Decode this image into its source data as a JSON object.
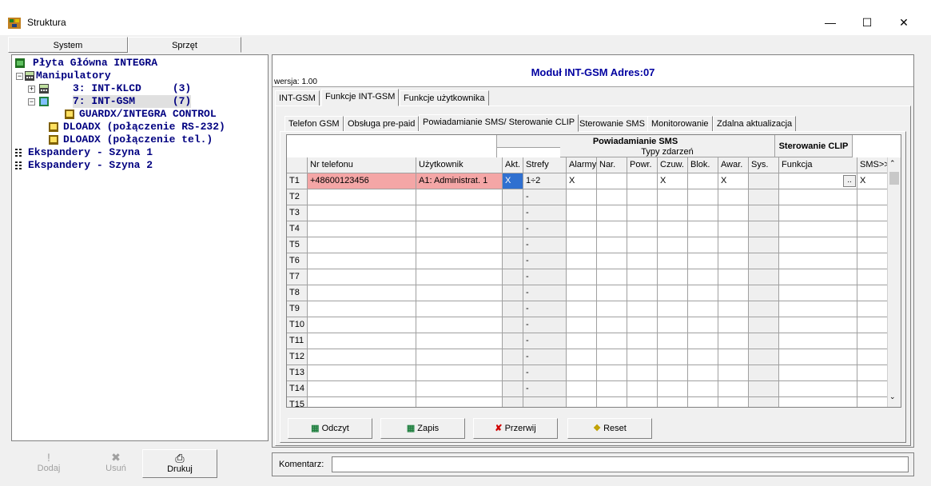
{
  "window": {
    "title": "Struktura"
  },
  "left_tabs": [
    "System",
    "Sprzęt"
  ],
  "tree": [
    {
      "label": "Płyta Główna INTEGRA"
    },
    {
      "label": "Manipulatory"
    },
    {
      "label": "3: INT-KLCD     (3)"
    },
    {
      "label": "7: INT-GSM      (7)"
    },
    {
      "label": "GUARDX/INTEGRA CONTROL"
    },
    {
      "label": "DLOADX (połączenie RS-232)"
    },
    {
      "label": "DLOADX (połączenie tel.)"
    },
    {
      "label": "Ekspandery - Szyna 1"
    },
    {
      "label": "Ekspandery - Szyna 2"
    }
  ],
  "left_buttons": {
    "add": "Dodaj",
    "remove": "Usuń",
    "print": "Drukuj"
  },
  "header": {
    "module": "Moduł INT-GSM Adres:07",
    "version": "wersja: 1.00"
  },
  "main_tabs": [
    "INT-GSM",
    "Funkcje INT-GSM",
    "Funkcje użytkownika"
  ],
  "sub_tabs": [
    "Telefon GSM",
    "Obsługa pre-paid",
    "Powiadamianie SMS/ Sterowanie CLIP",
    "Sterowanie SMS",
    "Monitorowanie",
    "Zdalna aktualizacja"
  ],
  "grid": {
    "group_sms": "Powiadamianie SMS",
    "group_events": "Typy zdarzeń",
    "group_clip": "Sterowanie CLIP",
    "columns": [
      "Nr telefonu",
      "Użytkownik",
      "Akt.",
      "Strefy",
      "Alarmy",
      "Nar.",
      "Powr.",
      "Czuw.",
      "Blok.",
      "Awar.",
      "Sys.",
      "Funkcja",
      "SMS>>"
    ],
    "rows": [
      {
        "id": "T1",
        "phone": "+48600123456",
        "user": "A1: Administrat. 1",
        "akt": "X",
        "strefy": "1÷2",
        "alarmy": "X",
        "nar": "",
        "powr": "",
        "czuw": "X",
        "blok": "",
        "awar": "X",
        "sys": "",
        "funkcja": "",
        "sms": "X"
      },
      {
        "id": "T2",
        "strefy": "-"
      },
      {
        "id": "T3",
        "strefy": "-"
      },
      {
        "id": "T4",
        "strefy": "-"
      },
      {
        "id": "T5",
        "strefy": "-"
      },
      {
        "id": "T6",
        "strefy": "-"
      },
      {
        "id": "T7",
        "strefy": "-"
      },
      {
        "id": "T8",
        "strefy": "-"
      },
      {
        "id": "T9",
        "strefy": "-"
      },
      {
        "id": "T10",
        "strefy": "-"
      },
      {
        "id": "T11",
        "strefy": "-"
      },
      {
        "id": "T12",
        "strefy": "-"
      },
      {
        "id": "T13",
        "strefy": "-"
      },
      {
        "id": "T14",
        "strefy": "-"
      },
      {
        "id": "T15",
        "strefy": ""
      }
    ],
    "ellipsis": ".."
  },
  "bottom_buttons": {
    "read": "Odczyt",
    "write": "Zapis",
    "abort": "Przerwij",
    "reset": "Reset"
  },
  "comment": {
    "label": "Komentarz:",
    "value": ""
  },
  "colors": {
    "selected_row": "#f4a6a6",
    "title_blue": "#0000a0",
    "tree_blue": "#000080"
  }
}
